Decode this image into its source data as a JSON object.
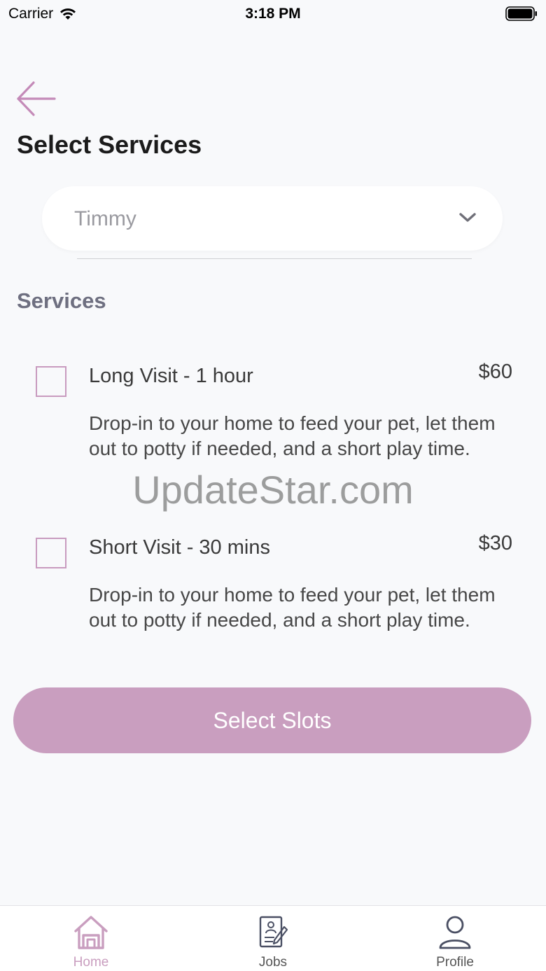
{
  "status_bar": {
    "carrier": "Carrier",
    "time": "3:18 PM"
  },
  "header": {
    "title": "Select Services",
    "back_icon": "arrow-left-icon"
  },
  "pet_select": {
    "value": "Timmy",
    "icon": "chevron-down-icon"
  },
  "services_section": {
    "heading": "Services",
    "items": [
      {
        "name": "Long Visit - 1 hour",
        "price": "$60",
        "description": "Drop-in to your home to feed your pet, let them out to potty if needed, and a short play time.",
        "checked": false
      },
      {
        "name": "Short Visit - 30 mins",
        "price": "$30",
        "description": "Drop-in to your home to feed your pet, let them out to potty if needed, and a short play time.",
        "checked": false
      }
    ]
  },
  "cta": {
    "label": "Select Slots"
  },
  "watermark": "UpdateStar.com",
  "tab_bar": {
    "tabs": [
      {
        "label": "Home",
        "icon": "home-icon",
        "active": true
      },
      {
        "label": "Jobs",
        "icon": "jobs-document-icon",
        "active": false
      },
      {
        "label": "Profile",
        "icon": "profile-icon",
        "active": false
      }
    ]
  },
  "colors": {
    "accent": "#c99ebf",
    "background": "#f8f9fb",
    "heading_muted": "#6e6f80"
  }
}
